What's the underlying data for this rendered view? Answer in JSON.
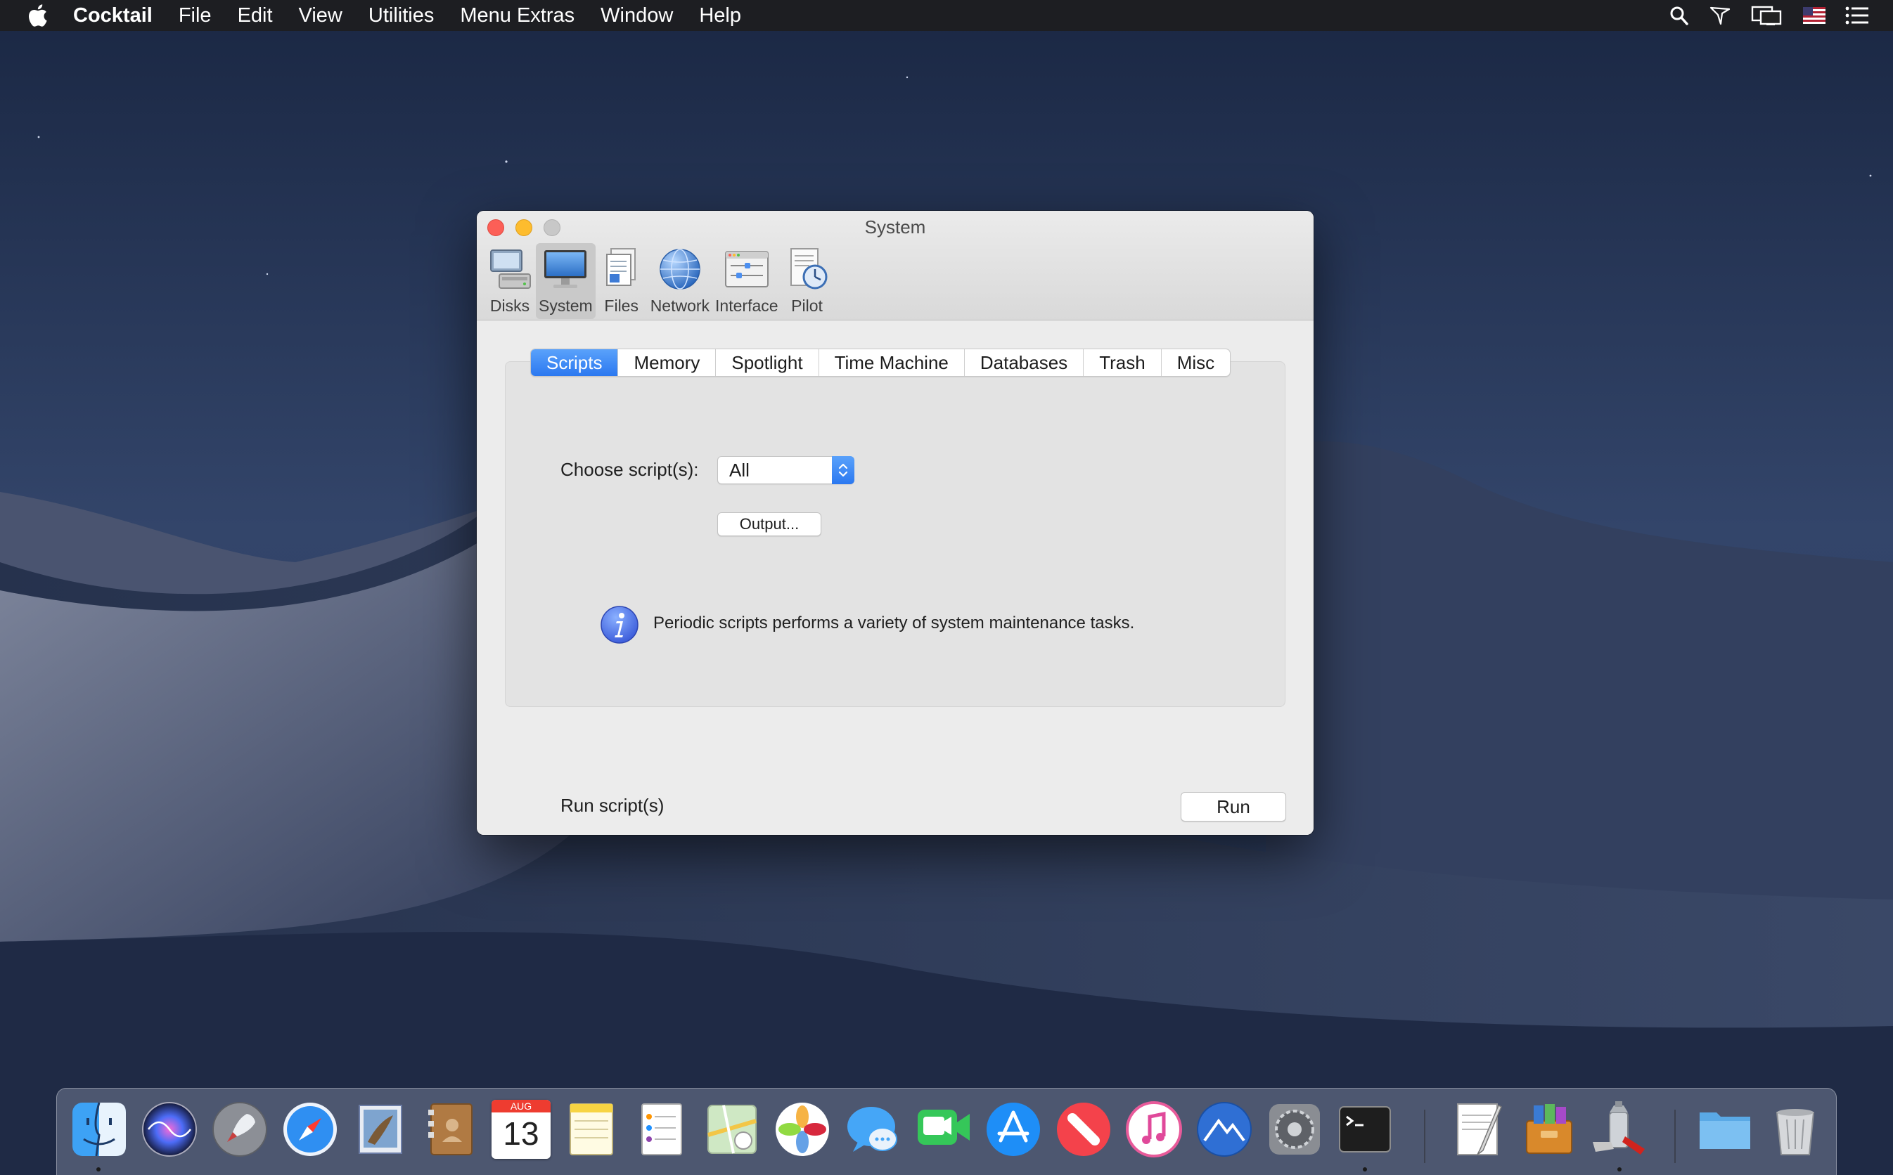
{
  "menubar": {
    "app_name": "Cocktail",
    "items": [
      "File",
      "Edit",
      "View",
      "Utilities",
      "Menu Extras",
      "Window",
      "Help"
    ],
    "status_icons": [
      "spotlight-search-icon",
      "cocktail-pilot-icon",
      "display-mirroring-icon",
      "us-flag-input-icon",
      "notification-center-icon"
    ]
  },
  "window": {
    "title": "System",
    "toolbar": [
      {
        "label": "Disks",
        "icon": "disks-icon"
      },
      {
        "label": "System",
        "icon": "system-icon",
        "active": true
      },
      {
        "label": "Files",
        "icon": "files-icon"
      },
      {
        "label": "Network",
        "icon": "network-icon"
      },
      {
        "label": "Interface",
        "icon": "interface-icon"
      },
      {
        "label": "Pilot",
        "icon": "pilot-icon"
      }
    ],
    "tabs": [
      {
        "label": "Scripts",
        "active": true
      },
      {
        "label": "Memory"
      },
      {
        "label": "Spotlight"
      },
      {
        "label": "Time Machine"
      },
      {
        "label": "Databases"
      },
      {
        "label": "Trash"
      },
      {
        "label": "Misc"
      }
    ],
    "scripts": {
      "choose_label": "Choose script(s):",
      "selected_script": "All",
      "output_button": "Output...",
      "info_text": "Periodic scripts performs a variety of system maintenance tasks.",
      "run_label": "Run script(s)",
      "run_button": "Run"
    }
  },
  "dock": {
    "calendar_month": "AUG",
    "calendar_day": "13",
    "items": [
      "finder-icon",
      "siri-icon",
      "launchpad-icon",
      "safari-icon",
      "mail-icon",
      "contacts-icon",
      "calendar-icon",
      "notes-icon",
      "reminders-icon",
      "maps-icon",
      "photos-icon",
      "messages-icon",
      "facetime-icon",
      "app-store-icon",
      "news-icon",
      "itunes-icon",
      "altitude-icon",
      "system-preferences-icon",
      "terminal-icon",
      "textedit-icon",
      "archive-utility-icon",
      "cocktail-icon",
      "documents-folder-icon",
      "trash-icon"
    ]
  },
  "colors": {
    "accent": "#3b86f6",
    "close": "#fc5f57",
    "minimize": "#fdbc2e",
    "zoom_disabled": "#c8c8c8"
  }
}
